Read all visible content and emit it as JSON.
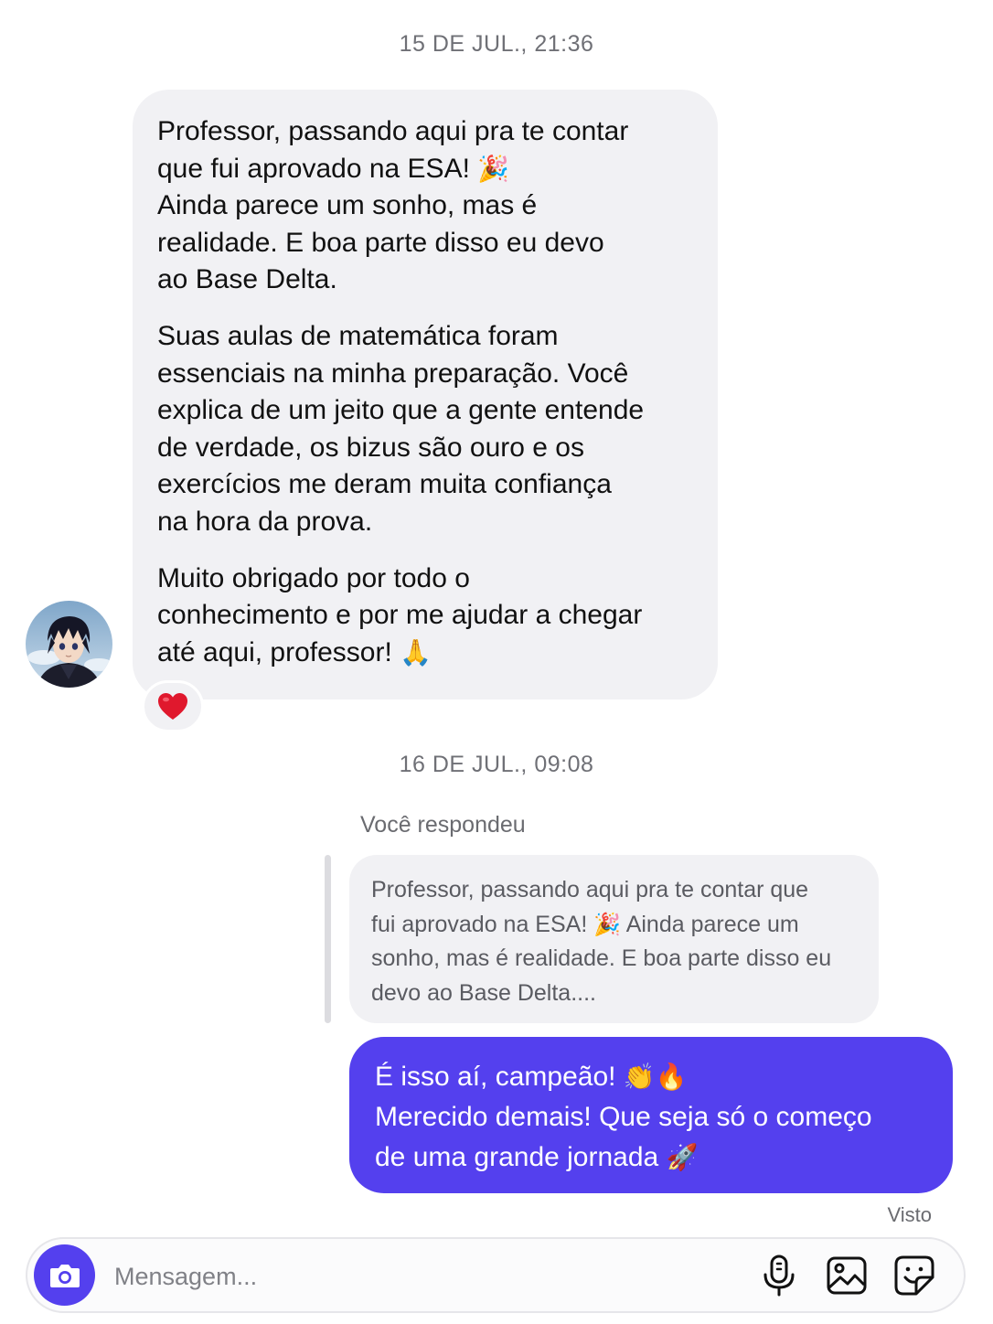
{
  "thread": {
    "timestamp_1": "15 DE JUL., 21:36",
    "timestamp_2": "16 DE JUL., 09:08",
    "incoming": {
      "avatar_icon": "anime-boy-avatar",
      "para1_line1": "Professor, passando aqui pra te contar",
      "para1_line2": "que fui aprovado na ESA!",
      "para1_emoji": "🎉",
      "para1_line3": "Ainda parece um sonho, mas é",
      "para1_line4": "realidade. E boa parte disso eu devo",
      "para1_line5": "ao Base Delta.",
      "para2_line1": "Suas aulas de matemática foram",
      "para2_line2": "essenciais na minha preparação. Você",
      "para2_line3": "explica de um jeito que a gente entende",
      "para2_line4": "de verdade, os bizus são ouro e os",
      "para2_line5": "exercícios me deram muita confiança",
      "para2_line6": "na hora da prova.",
      "para3_line1": "Muito obrigado por todo o",
      "para3_line2": "conhecimento e por me ajudar a chegar",
      "para3_line3": "até aqui, professor!",
      "para3_emoji": "🙏",
      "reaction_icon": "heart-icon"
    },
    "reply": {
      "label": "Você respondeu",
      "quoted_line1": "Professor, passando aqui pra te contar que",
      "quoted_line2a": "fui aprovado na ESA!",
      "quoted_emoji": "🎉",
      "quoted_line2b": " Ainda parece um",
      "quoted_line3": "sonho, mas é realidade. E boa parte disso eu",
      "quoted_line4": "devo ao Base Delta...."
    },
    "outgoing": {
      "line1": "É isso aí, campeão!",
      "line1_emoji": "👏🔥",
      "line2": "Merecido demais! Que seja só o começo",
      "line3": "de uma grande jornada",
      "line3_emoji": "🚀",
      "status": "Visto"
    }
  },
  "composer": {
    "placeholder": "Mensagem...",
    "camera_icon": "camera-icon",
    "mic_icon": "microphone-icon",
    "gallery_icon": "image-gallery-icon",
    "sticker_icon": "sticker-icon"
  },
  "colors": {
    "accent": "#5440ee",
    "incoming_bubble": "#f1f1f4",
    "timestamp": "#6f7076",
    "heart": "#e0182d"
  }
}
